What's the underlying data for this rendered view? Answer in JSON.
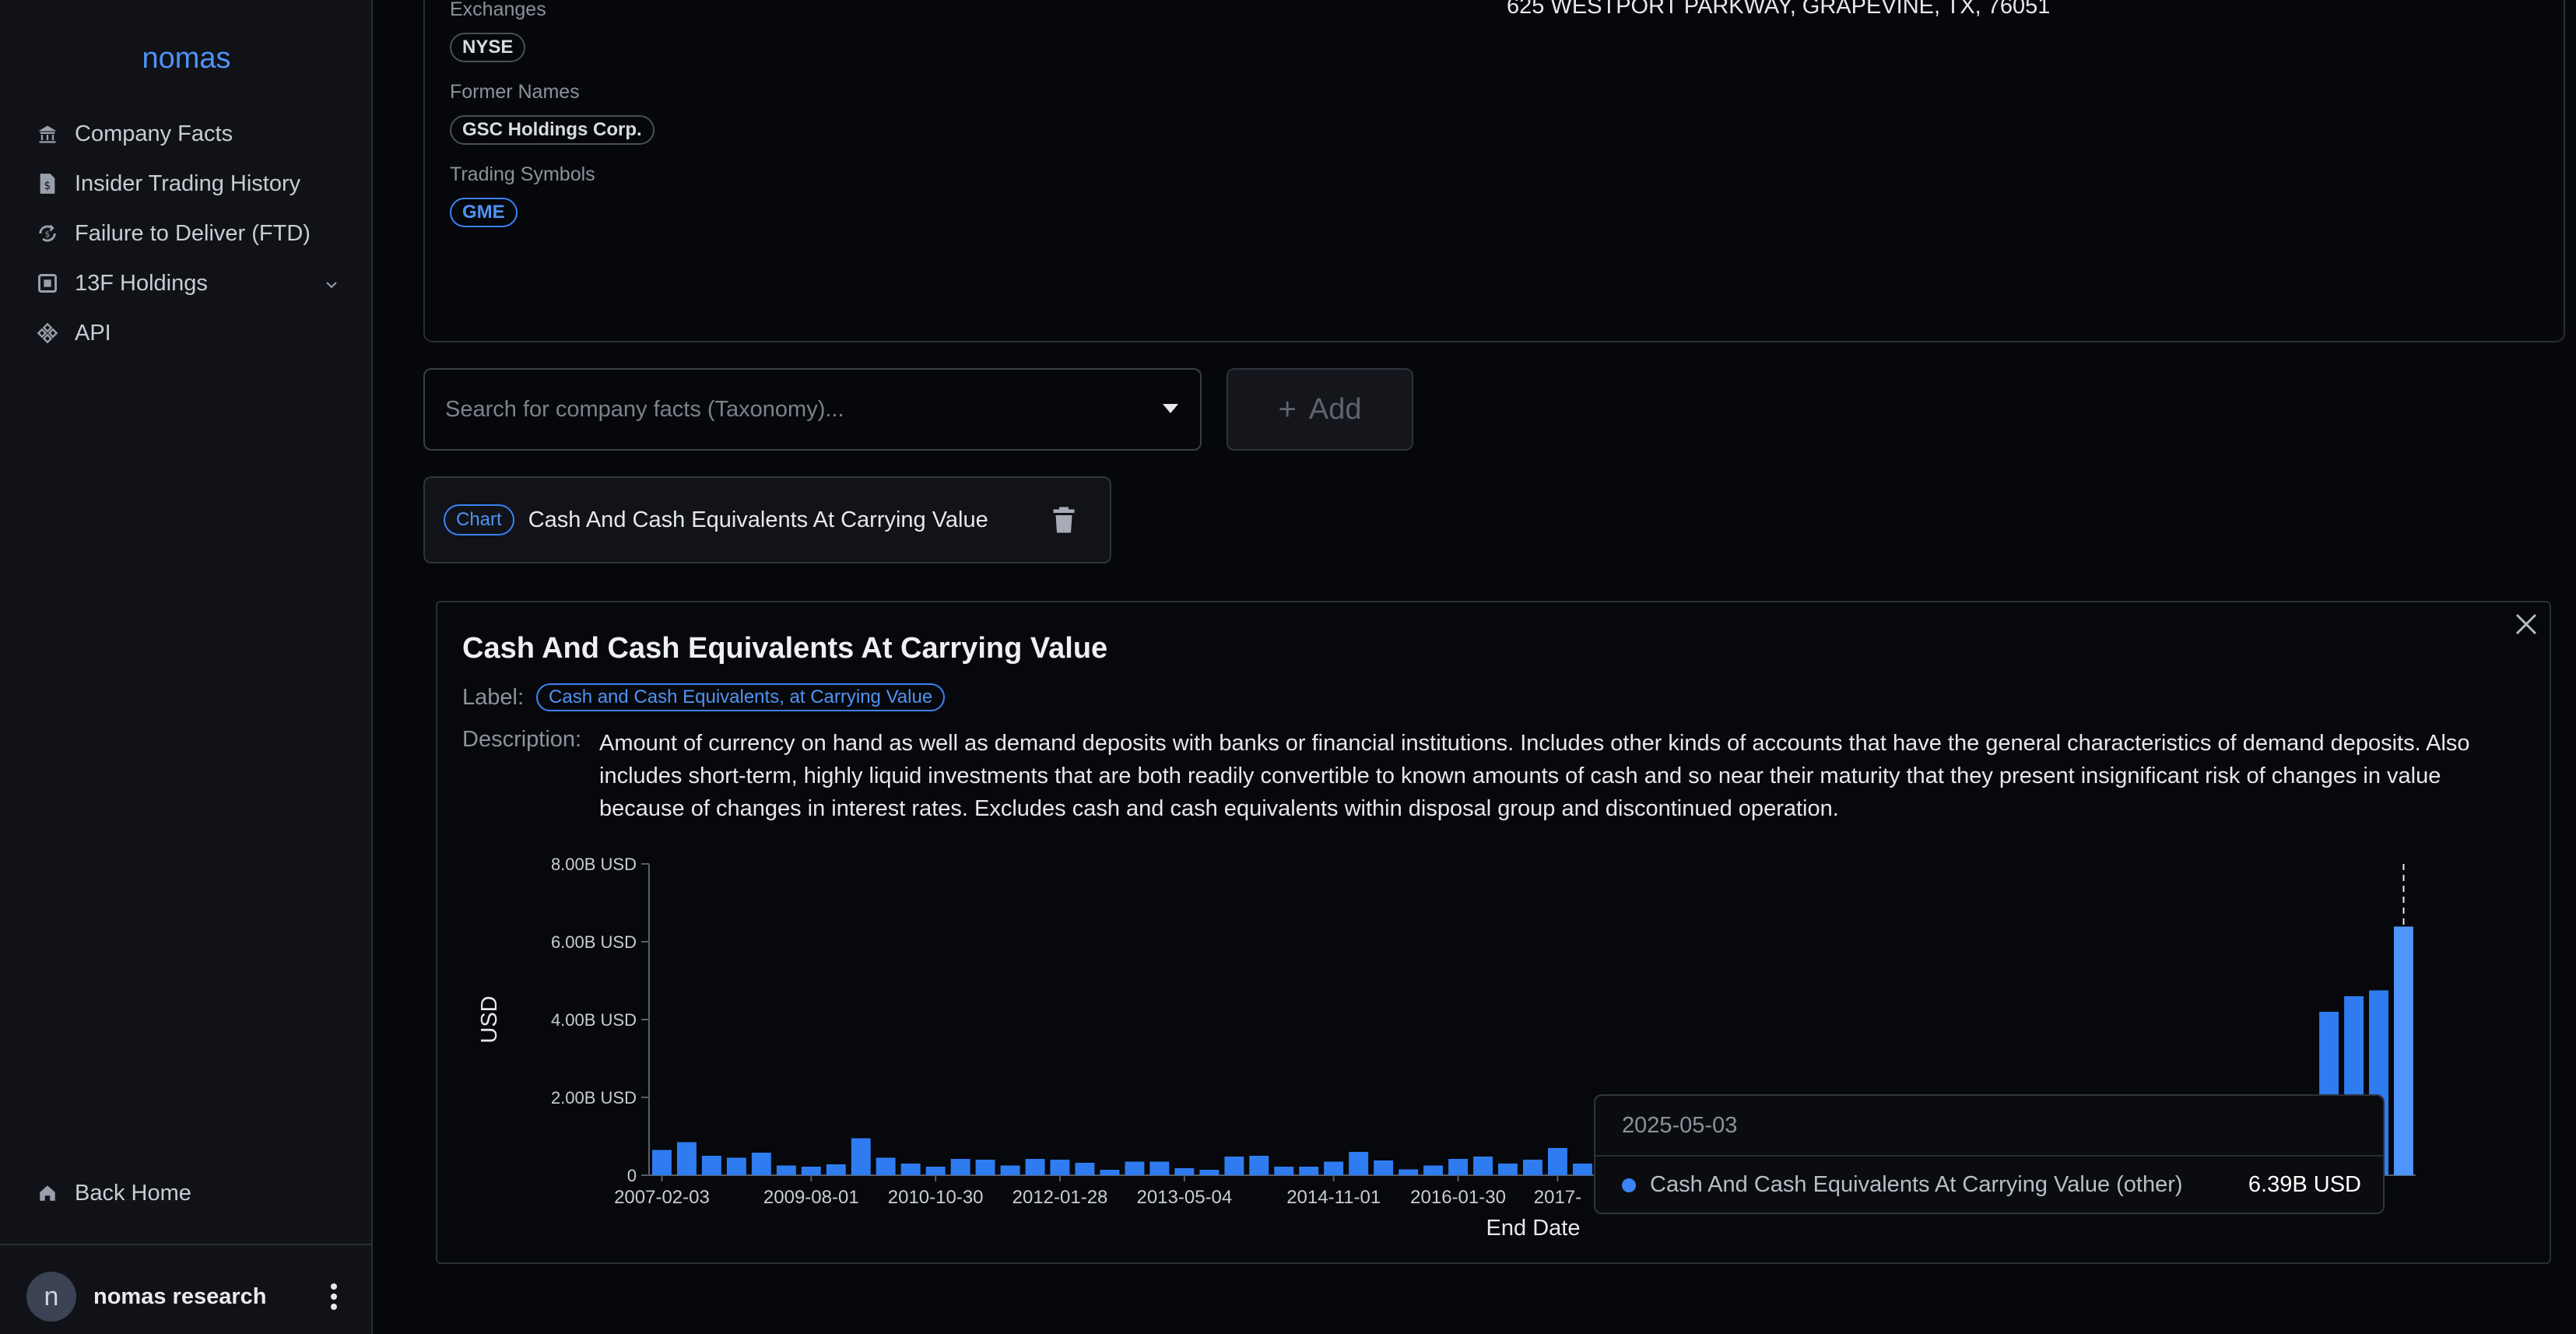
{
  "sidebar": {
    "brand": "nomas",
    "items": [
      {
        "label": "Company Facts"
      },
      {
        "label": "Insider Trading History"
      },
      {
        "label": "Failure to Deliver (FTD)"
      },
      {
        "label": "13F Holdings"
      },
      {
        "label": "API"
      }
    ],
    "back_home": "Back Home",
    "user": {
      "initial": "n",
      "name": "nomas research"
    }
  },
  "company": {
    "exchanges_label": "Exchanges",
    "exchanges": [
      "NYSE"
    ],
    "former_names_label": "Former Names",
    "former_names": [
      "GSC Holdings Corp."
    ],
    "trading_symbols_label": "Trading Symbols",
    "trading_symbols": [
      "GME"
    ],
    "address": "625 WESTPORT PARKWAY, GRAPEVINE, TX, 76051"
  },
  "search": {
    "placeholder": "Search for company facts (Taxonomy)...",
    "add_label": "Add"
  },
  "chip": {
    "badge": "Chart",
    "title": "Cash And Cash Equivalents At Carrying Value"
  },
  "panel": {
    "title": "Cash And Cash Equivalents At Carrying Value",
    "label_key": "Label:",
    "label_value": "Cash and Cash Equivalents, at Carrying Value",
    "description_key": "Description:",
    "description": "Amount of currency on hand as well as demand deposits with banks or financial institutions. Includes other kinds of accounts that have the general characteristics of demand deposits. Also includes short-term, highly liquid investments that are both readily convertible to known amounts of cash and so near their maturity that they present insignificant risk of changes in value because of changes in interest rates. Excludes cash and cash equivalents within disposal group and discontinued operation."
  },
  "tooltip": {
    "date": "2025-05-03",
    "series": "Cash And Cash Equivalents At Carrying Value (other)",
    "value": "6.39B USD"
  },
  "chart_data": {
    "type": "bar",
    "xlabel": "End Date",
    "ylabel": "USD",
    "ylim": [
      0,
      8.0
    ],
    "y_ticks": [
      "0",
      "2.00B USD",
      "4.00B USD",
      "6.00B USD",
      "8.00B USD"
    ],
    "x_tick_labels": [
      "2007-02-03",
      "2009-08-01",
      "2010-10-30",
      "2012-01-28",
      "2013-05-04",
      "2014-11-01",
      "2016-01-30",
      "2017-"
    ],
    "x_tick_index": [
      0,
      6,
      11,
      16,
      21,
      27,
      32,
      36
    ],
    "values": [
      0.65,
      0.85,
      0.5,
      0.45,
      0.58,
      0.25,
      0.22,
      0.28,
      0.95,
      0.45,
      0.3,
      0.22,
      0.42,
      0.4,
      0.25,
      0.42,
      0.4,
      0.32,
      0.14,
      0.35,
      0.35,
      0.18,
      0.14,
      0.48,
      0.5,
      0.22,
      0.22,
      0.35,
      0.6,
      0.38,
      0.15,
      0.25,
      0.42,
      0.48,
      0.3,
      0.4,
      0.7,
      0.3,
      0.2,
      0.2,
      0.25,
      0.3,
      0.35,
      0.3,
      0.25,
      0.2,
      0.25,
      0.3,
      0.2,
      0.25,
      0.3,
      0.25,
      0.2,
      0.2,
      0.3,
      0.35,
      0.3,
      0.25,
      0.3,
      0.35,
      0.4,
      0.35,
      0.4,
      0.35,
      0.4,
      0.4,
      0.45,
      4.2,
      4.6,
      4.75,
      6.39
    ],
    "highlight_index": 70,
    "accent": "#2f7cf0",
    "highlight_color": "#4e95ff"
  }
}
